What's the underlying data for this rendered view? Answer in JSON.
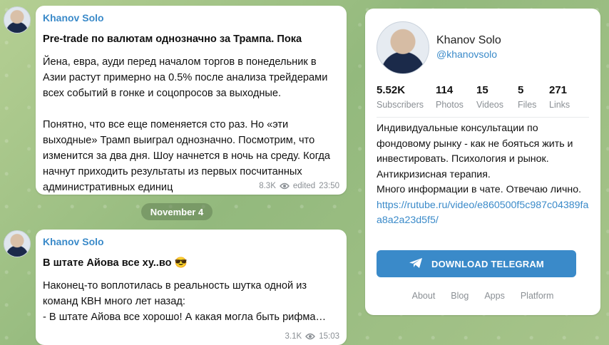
{
  "posts": [
    {
      "author": "Khanov Solo",
      "title": "Pre-trade по валютам однозначно за Трампа. Пока",
      "body": "Йена, евра, ауди перед началом торгов в понедельник в Азии растут примерно на 0.5% после анализа трейдерами всех событий в гонке и соцопросов за выходные.\n\nПонятно, что все еще поменяется сто раз. Но «эти выходные» Трамп выиграл однозначно. Посмотрим, что изменится за два дня. Шоу начнется в ночь на среду. Когда начнут приходить результаты из первых посчитанных административных единиц",
      "views": "8.3K",
      "edited": "edited",
      "time": "23:50"
    },
    {
      "author": "Khanov Solo",
      "title": "В штате Айова все ху..во 😎",
      "body": "Наконец-то воплотилась в реальность шутка одной из команд КВН много лет назад:\n- В штате Айова все хорошо! А какая могла быть рифма…",
      "views": "3.1K",
      "time": "15:03"
    }
  ],
  "date_separator": "November 4",
  "channel": {
    "name": "Khanov Solo",
    "handle": "@khanovsolo",
    "stats": [
      {
        "value": "5.52K",
        "label": "Subscribers"
      },
      {
        "value": "114",
        "label": "Photos"
      },
      {
        "value": "15",
        "label": "Videos"
      },
      {
        "value": "5",
        "label": "Files"
      },
      {
        "value": "271",
        "label": "Links"
      }
    ],
    "description": "Индивидуальные консультации по фондовому рынку - как не бояться жить и инвестировать. Психология и рынок. Антикризисная терапия.\nМного информации в чате. Отвечаю лично.",
    "link": "https://rutube.ru/video/e860500f5c987c04389faa8a2a23d5f5/",
    "download_label": "DOWNLOAD TELEGRAM",
    "footer_links": [
      "About",
      "Blog",
      "Apps",
      "Platform"
    ]
  },
  "colors": {
    "accent": "#3a8ac9",
    "background": "#9fbf86"
  }
}
